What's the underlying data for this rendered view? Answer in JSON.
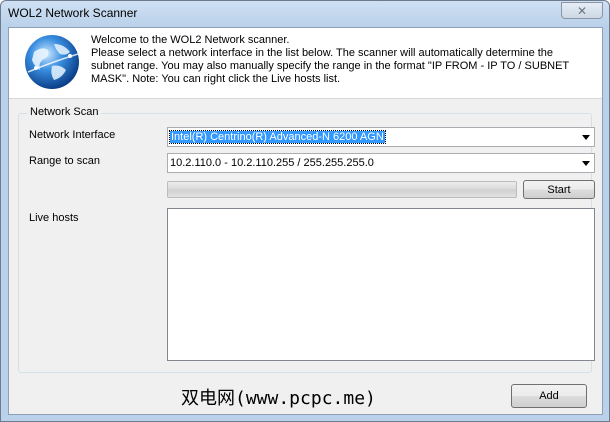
{
  "window": {
    "title": "WOL2 Network Scanner",
    "close_glyph": "✕"
  },
  "header": {
    "icon": "globe-network-icon",
    "welcome_lines": [
      "Welcome to the WOL2 Network scanner.",
      "Please select a network interface in the list below. The scanner will automatically determine the",
      "subnet range. You may also manually specify the range in the format \"IP FROM - IP TO / SUBNET",
      "MASK\". Note: You can right click the Live hosts list."
    ]
  },
  "network_scan": {
    "group_label": "Network Scan",
    "interface_label": "Network Interface",
    "interface_value": "Intel(R) Centrino(R) Advanced-N 6200 AGN",
    "range_label": "Range to scan",
    "range_value": "10.2.110.0 - 10.2.110.255 / 255.255.255.0",
    "progress": 0,
    "start_label": "Start",
    "live_hosts_label": "Live hosts",
    "live_hosts": []
  },
  "footer": {
    "watermark": "双电网(www.pcpc.me)",
    "add_label": "Add"
  },
  "colors": {
    "selection": "#3399ff",
    "frame": "#b9d1ea"
  }
}
